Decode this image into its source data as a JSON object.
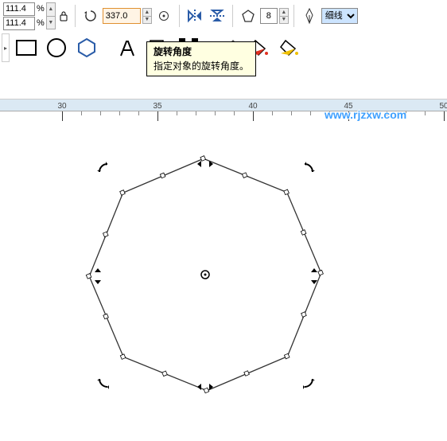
{
  "property_bar": {
    "scale_x": "111.4",
    "scale_y": "111.4",
    "percent": "%",
    "rotation": "337.0",
    "polygon_sides": "8",
    "outline_style": "细线"
  },
  "tooltip": {
    "title": "旋转角度",
    "body": "指定对象的旋转角度。"
  },
  "ruler": {
    "labels": [
      "30",
      "35",
      "40",
      "45",
      "50"
    ]
  },
  "watermark": "www.rjzxw.com"
}
